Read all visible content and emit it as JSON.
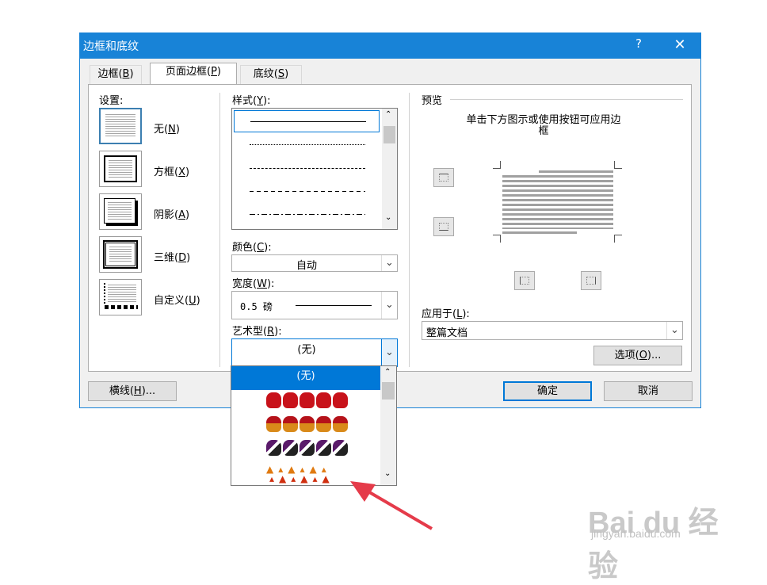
{
  "dialog": {
    "title": "边框和底纹",
    "help": "?",
    "close": "✕"
  },
  "tabs": [
    {
      "label": "边框(",
      "key": "B",
      "suffix": ")"
    },
    {
      "label": "页面边框(",
      "key": "P",
      "suffix": ")"
    },
    {
      "label": "底纹(",
      "key": "S",
      "suffix": ")"
    }
  ],
  "settings": {
    "heading": "设置:",
    "items": [
      {
        "label": "无(",
        "key": "N",
        "suffix": ")"
      },
      {
        "label": "方框(",
        "key": "X",
        "suffix": ")"
      },
      {
        "label": "阴影(",
        "key": "A",
        "suffix": ")"
      },
      {
        "label": "三维(",
        "key": "D",
        "suffix": ")"
      },
      {
        "label": "自定义(",
        "key": "U",
        "suffix": ")"
      }
    ]
  },
  "style": {
    "label": "样式(",
    "key": "Y",
    "suffix": "):"
  },
  "color": {
    "label": "颜色(",
    "key": "C",
    "suffix": "):",
    "value": "自动"
  },
  "width": {
    "label": "宽度(",
    "key": "W",
    "suffix": "):",
    "value": "0.5 磅"
  },
  "art": {
    "label": "艺术型(",
    "key": "R",
    "suffix": "):",
    "value": "(无)",
    "dropdown_selected": "(无)"
  },
  "preview": {
    "heading": "预览",
    "hint_line1": "单击下方图示或使用按钮可应用边",
    "hint_line2": "框"
  },
  "apply": {
    "label": "应用于(",
    "key": "L",
    "suffix": "):",
    "value": "整篇文档"
  },
  "buttons": {
    "options": {
      "label": "选项(",
      "key": "O",
      "suffix": ")..."
    },
    "hline": {
      "label": "横线(",
      "key": "H",
      "suffix": ")..."
    },
    "ok": "确定",
    "cancel": "取消"
  },
  "colors": {
    "accent": "#1883d7",
    "selection": "#0078d7",
    "arrow": "#e53b4a"
  },
  "watermark": {
    "brand": "Bai du 经验",
    "url": "jingyan.baidu.com"
  }
}
